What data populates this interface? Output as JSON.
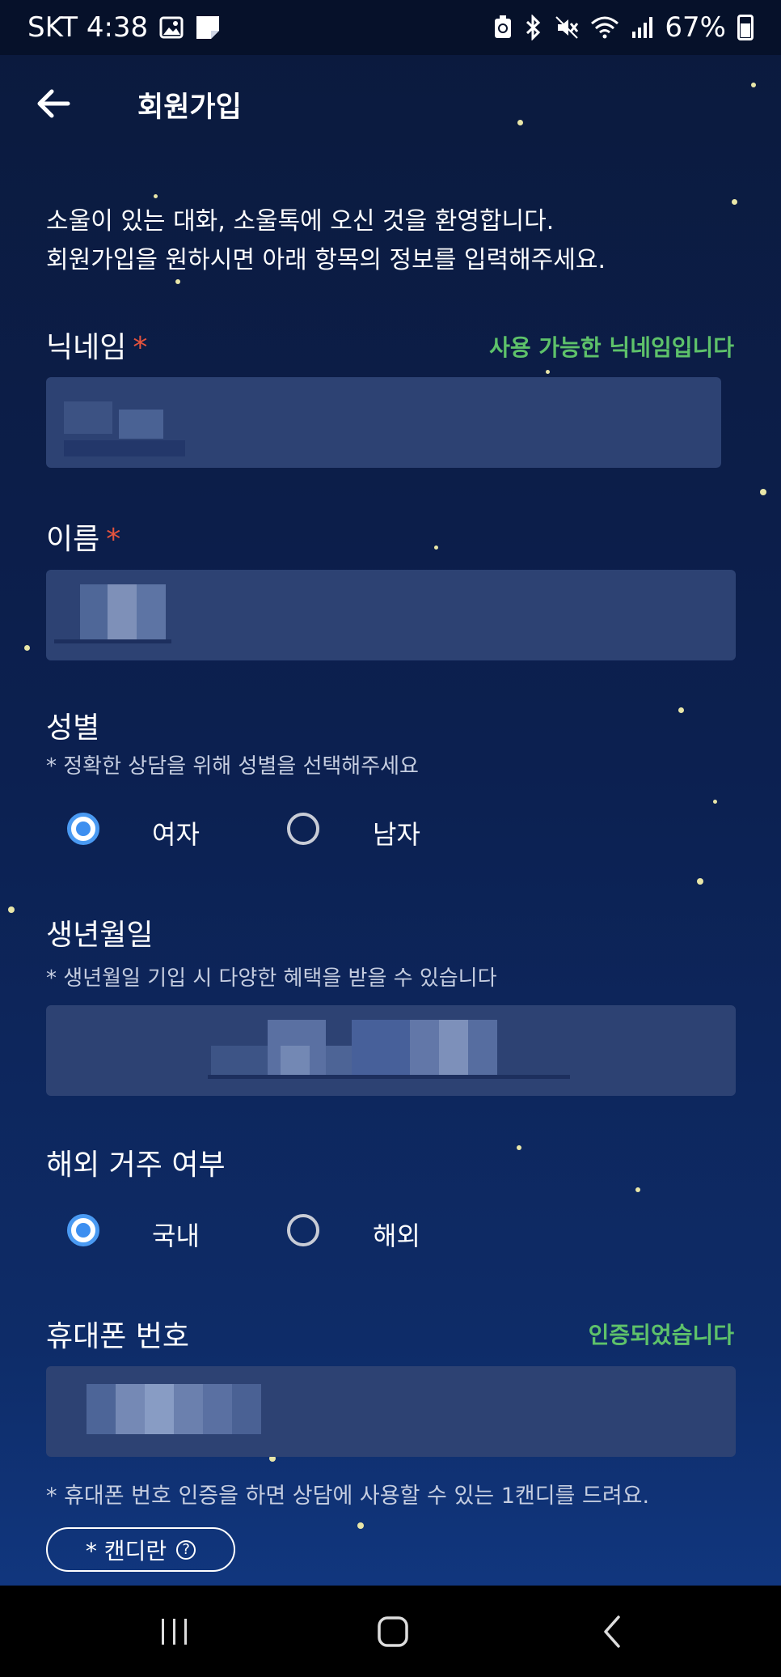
{
  "status_bar": {
    "carrier_time": "SKT 4:38",
    "battery": "67%",
    "icons": [
      "image-icon",
      "note-icon",
      "recycle-icon",
      "bluetooth-icon",
      "mute-icon",
      "wifi-icon",
      "signal-icon",
      "battery-icon"
    ]
  },
  "header": {
    "title": "회원가입",
    "back_icon": "arrow-left-icon"
  },
  "intro": {
    "line1": "소울이 있는 대화, 소울톡에 오신 것을 환영합니다.",
    "line2": "회원가입을 원하시면 아래 항목의 정보를 입력해주세요."
  },
  "nickname": {
    "label": "닉네임",
    "required_mark": "*",
    "status": "사용 가능한 닉네임입니다"
  },
  "name": {
    "label": "이름",
    "required_mark": "*"
  },
  "gender": {
    "label": "성별",
    "hint": "* 정확한 상담을 위해 성별을 선택해주세요",
    "options": [
      "여자",
      "남자"
    ],
    "selected": "여자"
  },
  "birthdate": {
    "label": "생년월일",
    "hint": "* 생년월일 기입 시 다양한 혜택을 받을 수 있습니다"
  },
  "residence": {
    "label": "해외 거주 여부",
    "options": [
      "국내",
      "해외"
    ],
    "selected": "국내"
  },
  "phone": {
    "label": "휴대폰 번호",
    "status": "인증되었습니다",
    "hint": "* 휴대폰 번호 인증을 하면 상담에 사용할 수 있는 1캔디를 드려요."
  },
  "candy_button": {
    "label": "* 캔디란",
    "icon": "question-circle-icon"
  },
  "nav_bar": {
    "buttons": [
      "recents-icon",
      "home-icon",
      "back-icon"
    ]
  },
  "colors": {
    "accent": "#3d8ff0",
    "success": "#5ec26a",
    "required": "#e5533d",
    "field_bg": "#2d4273"
  }
}
